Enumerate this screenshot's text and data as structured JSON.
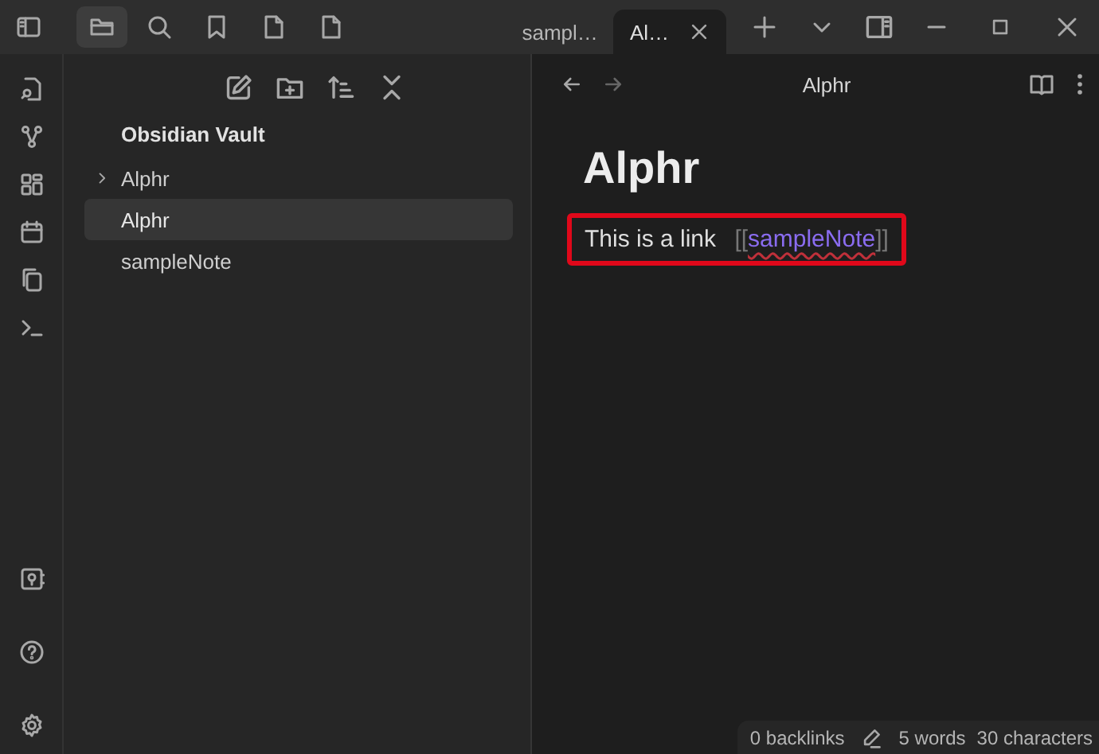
{
  "tabs": [
    {
      "label": "sampl…",
      "selected": false
    },
    {
      "label": "Al…",
      "selected": true
    }
  ],
  "file_tree": {
    "vault": "Obsidian Vault",
    "items": [
      {
        "label": "Alphr",
        "kind": "folder",
        "expanded": false,
        "selected": false
      },
      {
        "label": "Alphr",
        "kind": "file",
        "selected": true
      },
      {
        "label": "sampleNote",
        "kind": "file",
        "selected": false
      }
    ]
  },
  "note": {
    "header_title": "Alphr",
    "heading": "Alphr",
    "paragraph": {
      "text": "This is a link",
      "link_open": "[[",
      "link": "sampleNote",
      "link_close": "]]",
      "highlighted": true
    }
  },
  "status_bar": {
    "backlinks": "0 backlinks",
    "words": "5 words",
    "characters": "30 characters"
  }
}
